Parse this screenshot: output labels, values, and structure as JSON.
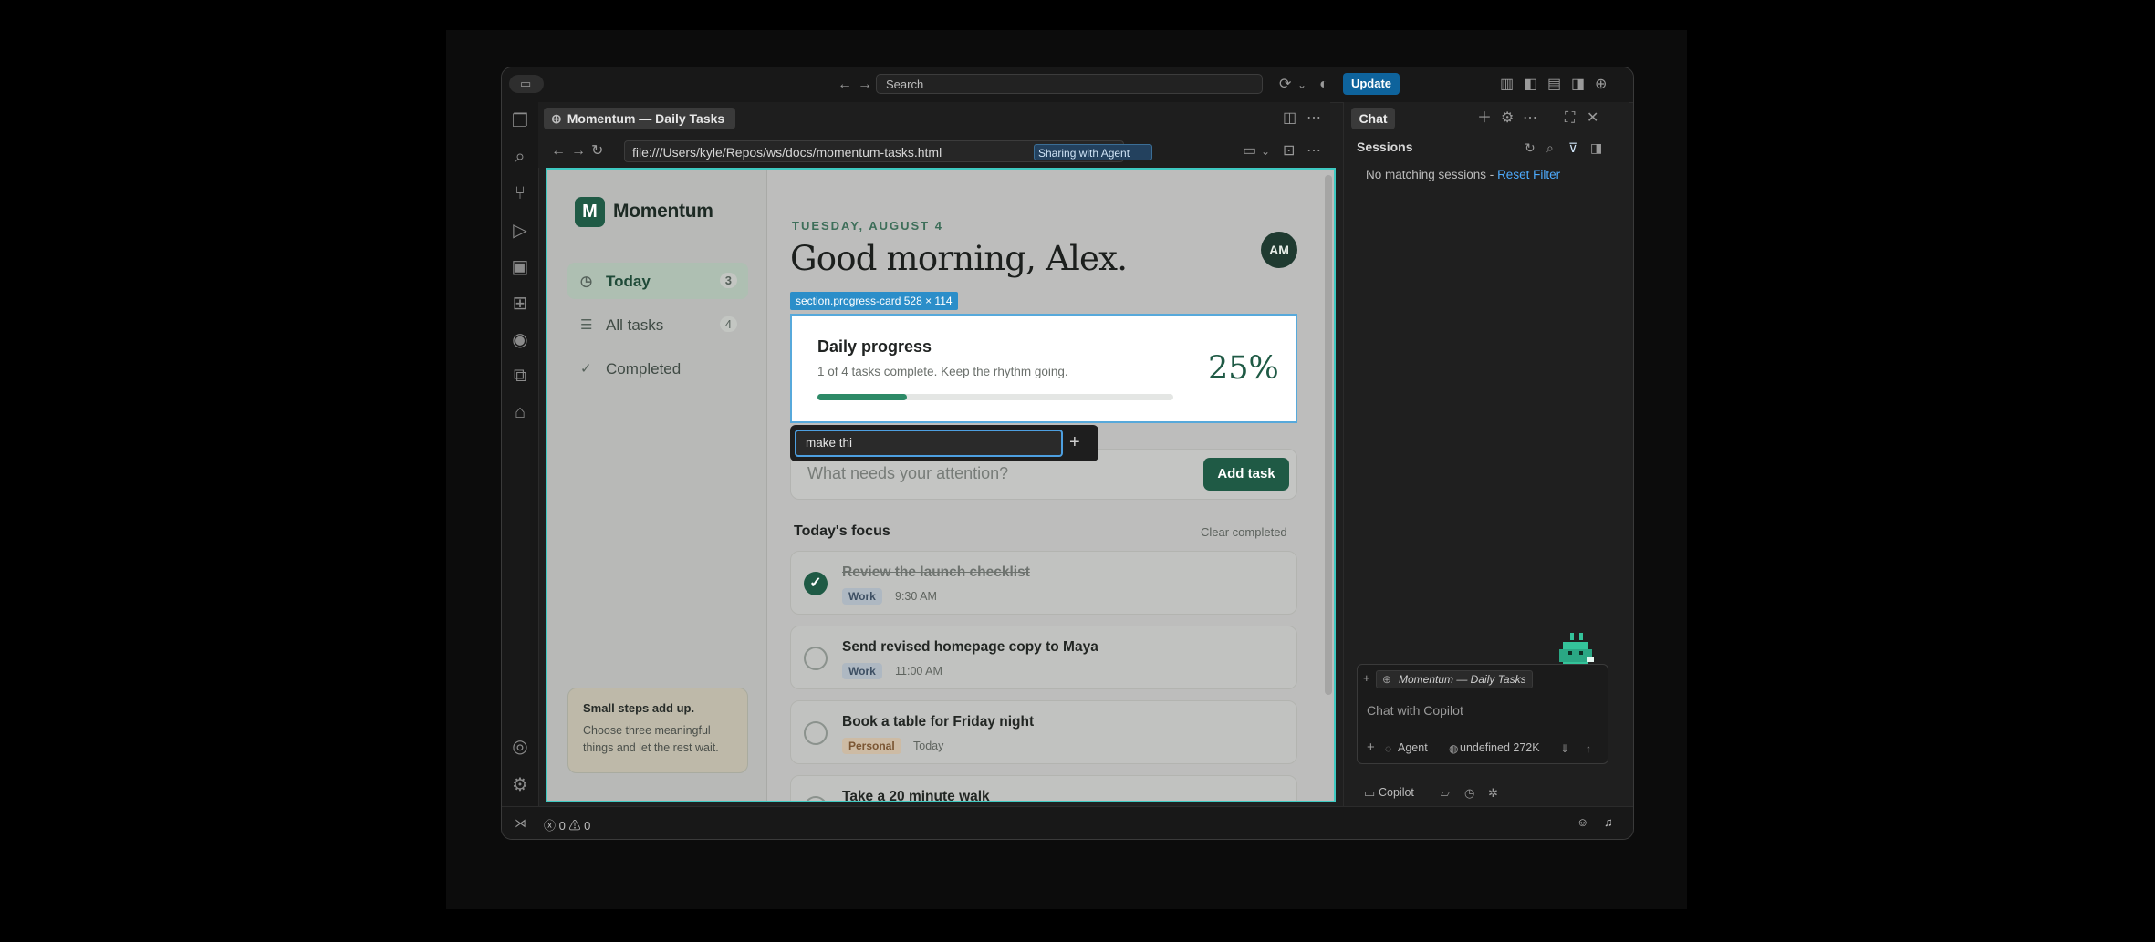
{
  "titlebar": {
    "search_placeholder": "Search",
    "update_label": "Update"
  },
  "editor": {
    "tab_title": "Momentum — Daily Tasks",
    "url": "file:///Users/kyle/Repos/ws/docs/momentum-tasks.html",
    "sharing_label": "Sharing with Agent"
  },
  "app": {
    "brand": "Momentum",
    "brand_initial": "M",
    "nav": [
      {
        "label": "Today",
        "count": "3",
        "icon": "clock-icon"
      },
      {
        "label": "All tasks",
        "count": "4",
        "icon": "list-icon"
      },
      {
        "label": "Completed",
        "count": "",
        "icon": "check-icon"
      }
    ],
    "tip": {
      "title": "Small steps add up.",
      "body": "Choose three meaningful things and let the rest wait."
    },
    "date": "TUESDAY, AUGUST 4",
    "greeting": "Good morning, Alex.",
    "avatar": "AM",
    "inspector_label": "section.progress-card  528 × 114",
    "progress": {
      "title": "Daily progress",
      "subtitle": "1 of 4 tasks complete. Keep the rhythm going.",
      "percent_label": "25%",
      "fraction": 0.25
    },
    "edit_popup": {
      "value": "make thi"
    },
    "add": {
      "placeholder": "What needs your attention?",
      "button": "Add task"
    },
    "focus": {
      "title": "Today's focus",
      "clear": "Clear completed"
    },
    "tasks": [
      {
        "title": "Review the launch checklist",
        "tag": "Work",
        "time": "9:30 AM",
        "done": true
      },
      {
        "title": "Send revised homepage copy to Maya",
        "tag": "Work",
        "time": "11:00 AM",
        "done": false
      },
      {
        "title": "Book a table for Friday night",
        "tag": "Personal",
        "time": "Today",
        "done": false
      },
      {
        "title": "Take a 20 minute walk",
        "tag": "",
        "time": "",
        "done": false
      }
    ]
  },
  "chat": {
    "tab": "Chat",
    "sessions_title": "Sessions",
    "no_match": "No matching sessions - ",
    "reset_filter": "Reset Filter",
    "context_chip": "Momentum — Daily Tasks",
    "input_placeholder": "Chat with Copilot",
    "agent_label": "Agent",
    "model_label": "undefined 272K",
    "footer_label": "Copilot"
  },
  "status": {
    "errors": "0",
    "warnings": "0"
  },
  "colors": {
    "accent": "#1f5a45",
    "update": "#0e639c",
    "highlight": "#3ec9c1",
    "link": "#4daafc"
  }
}
